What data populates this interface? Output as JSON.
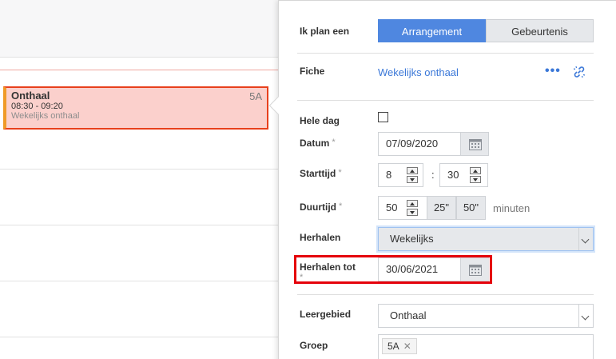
{
  "event": {
    "title": "Onthaal",
    "time": "08:30 - 09:20",
    "fiche": "Wekelijks onthaal",
    "group": "5A"
  },
  "form": {
    "plan_label": "Ik plan een",
    "plan_options": [
      "Arrangement",
      "Gebeurtenis"
    ],
    "plan_selected": "Arrangement",
    "fiche_label": "Fiche",
    "fiche_value": "Wekelijks onthaal",
    "fiche_more": "•••",
    "hele_dag_label": "Hele dag",
    "hele_dag_checked": false,
    "datum_label": "Datum",
    "datum_value": "07/09/2020",
    "starttijd_label": "Starttijd",
    "start_hour": "8",
    "start_colon": ":",
    "start_minute": "30",
    "duurtijd_label": "Duurtijd",
    "duur_value": "50",
    "duur_presets": [
      "25\"",
      "50\""
    ],
    "duur_unit": "minuten",
    "herhalen_label": "Herhalen",
    "herhalen_value": "Wekelijks",
    "herhalen_tot_label": "Herhalen tot",
    "herhalen_tot_value": "30/06/2021",
    "leergebied_label": "Leergebied",
    "leergebied_value": "Onthaal",
    "groep_label": "Groep",
    "groep_tags": [
      "5A"
    ],
    "tag_remove": "✕",
    "required_mark": "*"
  },
  "colors": {
    "accent": "#4f87e0",
    "link": "#3b78d8",
    "event_bg": "#fbd0cc",
    "event_border": "#e8401c",
    "highlight": "#e5000b"
  }
}
